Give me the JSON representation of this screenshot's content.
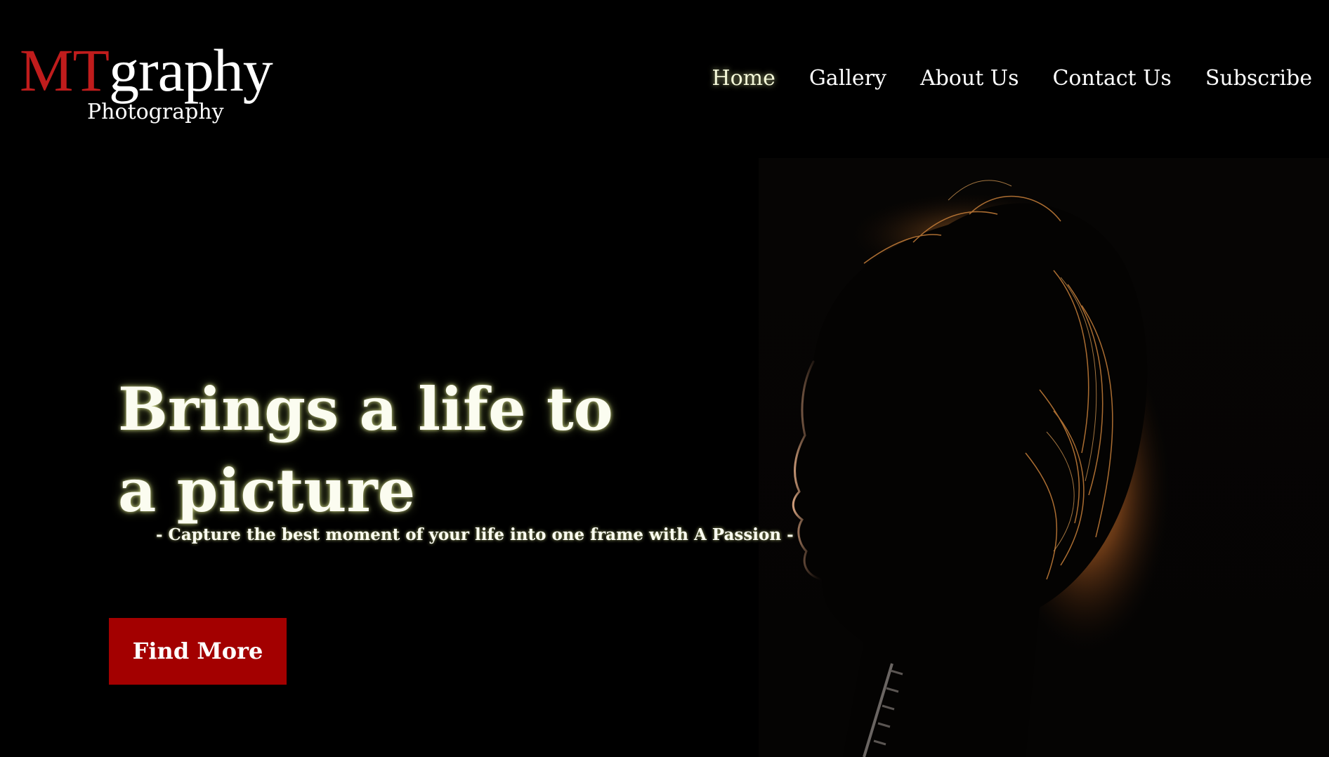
{
  "logo": {
    "mt": "MT",
    "graphy": "graphy",
    "sub": "Photography"
  },
  "nav": {
    "items": [
      {
        "label": "Home",
        "active": true
      },
      {
        "label": "Gallery",
        "active": false
      },
      {
        "label": "About Us",
        "active": false
      },
      {
        "label": "Contact Us",
        "active": false
      },
      {
        "label": "Subscribe",
        "active": false
      }
    ]
  },
  "hero": {
    "headline": "Brings a life to a picture",
    "subtitle": "- Capture the best moment of your life into one frame with A Passion -",
    "cta_label": "Find More"
  },
  "colors": {
    "background": "#000000",
    "logo_accent": "#c01c1c",
    "cta_background": "#a30000",
    "glow": "#f3f7d8"
  }
}
